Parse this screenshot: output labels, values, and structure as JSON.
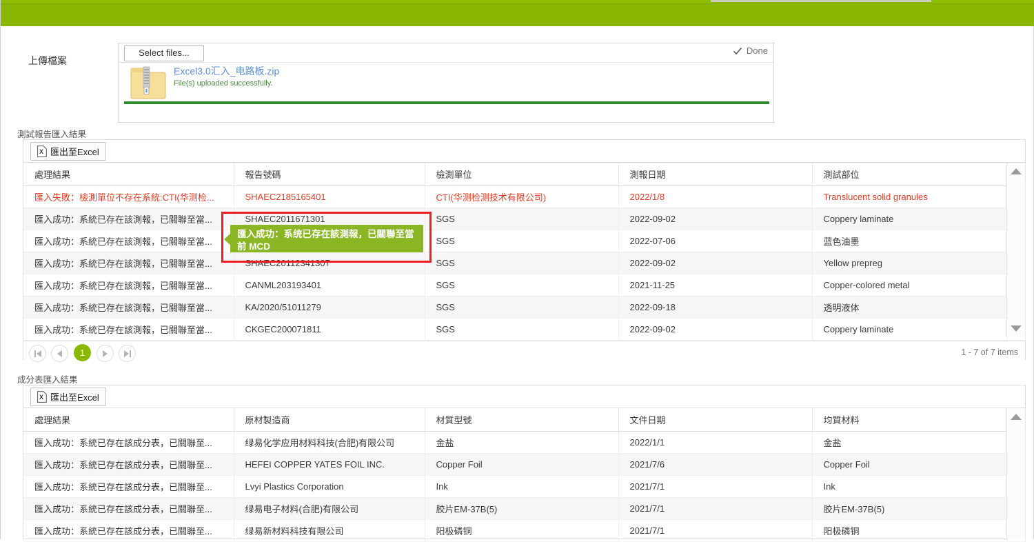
{
  "banner": {
    "color": "#8ab800"
  },
  "upload": {
    "label": "上傳檔案",
    "select_button": "Select files...",
    "done_label": "Done",
    "file_name": "Excel3.0汇入_电路板.zip",
    "file_status": "File(s) uploaded successfully."
  },
  "report_grid": {
    "title": "測試報告匯入結果",
    "export_button": "匯出至Excel",
    "columns": [
      "處理結果",
      "報告號碼",
      "檢測單位",
      "測報日期",
      "測試部位"
    ],
    "rows": [
      {
        "result": "匯入失敗：檢測單位不存在系統:CTI(华测检...",
        "report_no": "SHAEC2185165401",
        "lab": "CTI(华测检测技术有限公司)",
        "date": "2022/1/8",
        "part": "Translucent solid granules",
        "error": true
      },
      {
        "result": "匯入成功：系統已存在該測報，已關聯至當...",
        "report_no": "SHAEC2011671301",
        "lab": "SGS",
        "date": "2022-09-02",
        "part": "Coppery laminate",
        "error": false
      },
      {
        "result": "匯入成功：系統已存在該測報，已關聯至當...",
        "report_no": "",
        "lab": "SGS",
        "date": "2022-07-06",
        "part": "蓝色油墨",
        "error": false
      },
      {
        "result": "匯入成功：系統已存在該測報，已關聯至當...",
        "report_no": "SHAEC20112341307",
        "lab": "SGS",
        "date": "2022-09-02",
        "part": "Yellow prepreg",
        "error": false
      },
      {
        "result": "匯入成功：系統已存在該測報，已關聯至當...",
        "report_no": "CANML203193401",
        "lab": "SGS",
        "date": "2021-11-25",
        "part": "Copper-colored metal",
        "error": false
      },
      {
        "result": "匯入成功：系統已存在該測報，已關聯至當...",
        "report_no": "KA/2020/51011279",
        "lab": "SGS",
        "date": "2022-09-18",
        "part": "透明液体",
        "error": false
      },
      {
        "result": "匯入成功：系統已存在該測報，已關聯至當...",
        "report_no": "CKGEC200071811",
        "lab": "SGS",
        "date": "2022-09-02",
        "part": "Coppery laminate",
        "error": false
      }
    ],
    "pager": {
      "current_page": "1",
      "items_info": "1 - 7 of 7 items"
    }
  },
  "tooltip": {
    "text": "匯入成功：系统已存在該測報，已關聯至當前 MCD",
    "background": "#8ab624",
    "highlight_border": "#ee1c25"
  },
  "composition_grid": {
    "title": "成分表匯入結果",
    "export_button": "匯出至Excel",
    "columns": [
      "處理結果",
      "原材製造商",
      "材質型號",
      "文件日期",
      "均質材料"
    ],
    "rows": [
      {
        "result": "匯入成功：系統已存在該成分表，已關聯至...",
        "maker": "绿易化学应用材料科技(合肥)有限公司",
        "model": "金盐",
        "date": "2022/1/1",
        "material": "金盐"
      },
      {
        "result": "匯入成功：系統已存在該成分表，已關聯至...",
        "maker": "HEFEI COPPER YATES FOIL INC.",
        "model": "Copper Foil",
        "date": "2021/7/6",
        "material": "Copper Foil"
      },
      {
        "result": "匯入成功：系統已存在該成分表，已關聯至...",
        "maker": "Lvyi Plastics Corporation",
        "model": "Ink",
        "date": "2021/7/1",
        "material": "Ink"
      },
      {
        "result": "匯入成功：系統已存在該成分表，已關聯至...",
        "maker": "绿易电子材料(合肥)有限公司",
        "model": "胶片EM-37B(5)",
        "date": "2021/7/1",
        "material": "胶片EM-37B(5)"
      },
      {
        "result": "匯入成功：系統已存在該成分表，已關聯至...",
        "maker": "绿易新材料科技有限公司",
        "model": "阳极磷铜",
        "date": "2021/7/1",
        "material": "阳极磷铜"
      }
    ]
  }
}
